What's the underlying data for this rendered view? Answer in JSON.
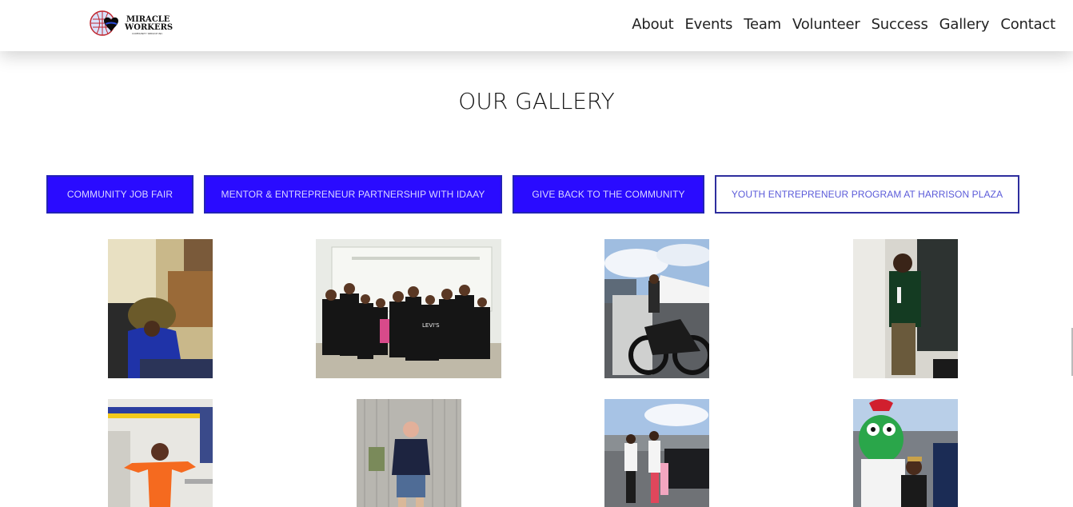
{
  "header": {
    "logo": {
      "line1": "MIRACLE",
      "line2": "WORKERS",
      "tagline": "COMMUNITY SERVICE INC"
    },
    "nav": [
      "About",
      "Events",
      "Team",
      "Volunteer",
      "Success",
      "Gallery",
      "Contact"
    ]
  },
  "page_title": "OUR GALLERY",
  "filters": [
    {
      "label": "COMMUNITY JOB FAIR",
      "active": true
    },
    {
      "label": "MENTOR & ENTREPRENEUR PARTNERSHIP WITH IDAAY",
      "active": true
    },
    {
      "label": "GIVE BACK TO THE COMMUNITY",
      "active": true
    },
    {
      "label": "YOUTH ENTREPRENEUR PROGRAM AT HARRISON PLAZA",
      "active": false
    }
  ],
  "colors": {
    "button_fill": "#2a0bff",
    "button_border": "#2323b5",
    "button_text": "#d9d6ff"
  },
  "gallery": [
    {
      "name": "photo-boy-hair-dryer"
    },
    {
      "name": "photo-group-classroom",
      "shirt_text": "LEVI'S"
    },
    {
      "name": "photo-motorcycle-event"
    },
    {
      "name": "photo-man-chalkboard"
    },
    {
      "name": "photo-girl-orange-shirt"
    },
    {
      "name": "photo-man-warehouse"
    },
    {
      "name": "photo-family-parking-lot"
    },
    {
      "name": "photo-phanatic-mascot"
    }
  ]
}
